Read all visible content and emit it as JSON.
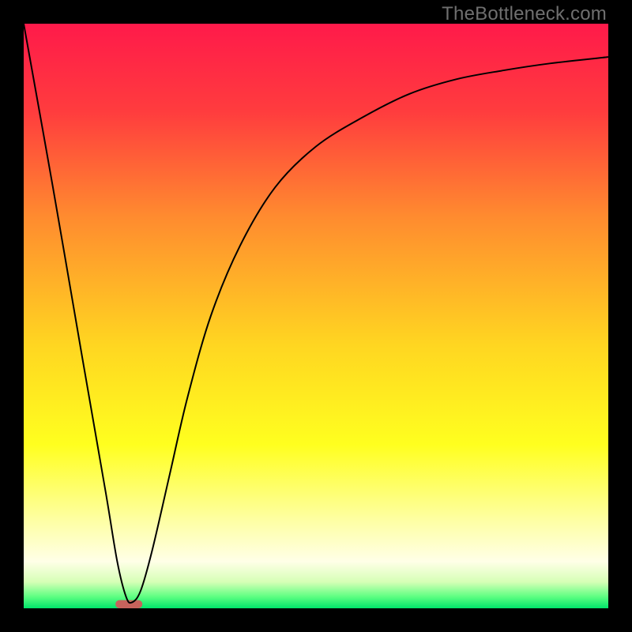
{
  "watermark": "TheBottleneck.com",
  "chart_data": {
    "type": "line",
    "title": "",
    "xlabel": "",
    "ylabel": "",
    "xlim": [
      0,
      100
    ],
    "ylim": [
      0,
      100
    ],
    "grid": false,
    "legend": false,
    "background_gradient_stops": [
      {
        "offset": 0.0,
        "color": "#ff1a4a"
      },
      {
        "offset": 0.15,
        "color": "#ff3c3e"
      },
      {
        "offset": 0.33,
        "color": "#ff8b2f"
      },
      {
        "offset": 0.55,
        "color": "#ffd621"
      },
      {
        "offset": 0.72,
        "color": "#ffff1f"
      },
      {
        "offset": 0.85,
        "color": "#feffa4"
      },
      {
        "offset": 0.92,
        "color": "#ffffe7"
      },
      {
        "offset": 0.955,
        "color": "#d6ffb6"
      },
      {
        "offset": 0.98,
        "color": "#5eff82"
      },
      {
        "offset": 1.0,
        "color": "#00e56a"
      }
    ],
    "series": [
      {
        "name": "bottleneck-curve",
        "color": "#000000",
        "x": [
          0,
          5,
          10,
          14,
          16,
          17.5,
          18.5,
          20,
          22,
          25,
          28,
          32,
          37,
          43,
          50,
          58,
          66,
          74,
          82,
          90,
          100
        ],
        "y": [
          100,
          72,
          43,
          20,
          8,
          2,
          1,
          3,
          10,
          23,
          36,
          50,
          62,
          72,
          79,
          84,
          88,
          90.5,
          92,
          93.2,
          94.3
        ]
      }
    ],
    "marker": {
      "name": "optimal-range",
      "color": "#c7635c",
      "x_center": 18,
      "x_half_width": 2.3,
      "y": 0,
      "height": 1.4
    }
  }
}
